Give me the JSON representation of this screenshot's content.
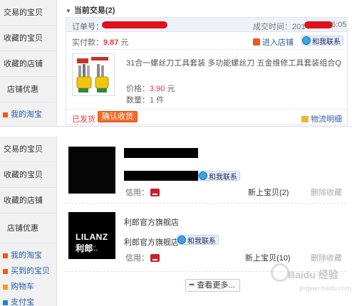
{
  "top_sidebar": {
    "items": [
      "交易的宝贝",
      "收藏的宝贝",
      "收藏的店铺",
      "店铺优惠"
    ],
    "links": [
      "我的淘宝"
    ]
  },
  "current_trades": {
    "heading": "当前交易(2)",
    "order_label": "订单号：",
    "deal_time_label": "成交时间：2014-",
    "deal_time_end": "6:05",
    "paid_label": "实付款：",
    "paid_amount": "9.87",
    "paid_unit": "元",
    "enter_shop": "进入店铺",
    "contact_me": "和我联系",
    "product_name": "31合一螺丝刀工具套装   多功能螺丝刀  五金维修工具套装组合Q",
    "price_label": "价格：",
    "price_value": "3.90",
    "price_unit": "元",
    "qty_label": "数量：",
    "qty_value": "1",
    "qty_unit": "件",
    "status": "已发货",
    "confirm_button": "确认收货",
    "logistics_link": "物流明细"
  },
  "bottom_sidebar": {
    "items": [
      "交易的宝贝",
      "收藏的宝贝",
      "收藏的店铺",
      "店铺优惠"
    ],
    "links": [
      "我的淘宝",
      "买到的宝贝",
      "购物车",
      "支付宝"
    ]
  },
  "shops": [
    {
      "name": "",
      "contact": "和我联系",
      "credit_label": "信用：",
      "new_items": "新上宝贝(2)",
      "unfollow": "删除收藏"
    },
    {
      "name": "利郎官方旗舰店",
      "seller": "利郎官方旗舰店",
      "logo_text": "LILANZ利郎",
      "logo_sub": "SIMPLE NOT SIMPLICATED",
      "contact": "和我联系",
      "credit_label": "信用：",
      "new_items": "新上宝贝(10)",
      "unfollow": "删除收藏"
    }
  ],
  "see_more": "查看更多...",
  "watermark": {
    "text": "Baidu 经验",
    "sub": "jingyan.baidu.com"
  },
  "colors": {
    "accent_red": "#e4393c",
    "link_blue": "#2a5caa",
    "button_orange": "#f46b29"
  }
}
